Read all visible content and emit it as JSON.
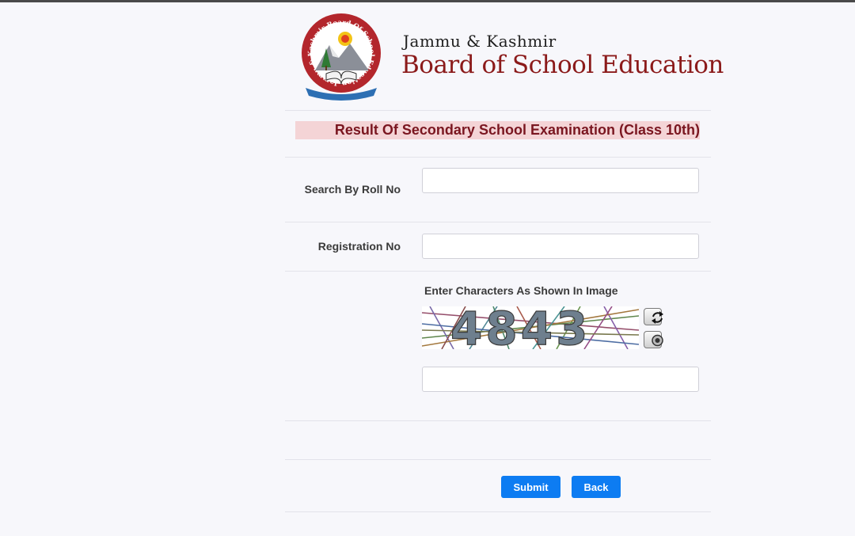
{
  "header": {
    "logo_name": "jkbose-emblem",
    "logo_ring_text": "Jammu & Kashmir Board Of School Education",
    "state_name": "Jammu & Kashmir",
    "board_name": "Board of School Education"
  },
  "page": {
    "heading": "Result Of Secondary School Examination (Class 10th)"
  },
  "form": {
    "roll_label": "Search By Roll No",
    "roll_value": "",
    "registration_label": "Registration No",
    "registration_value": "",
    "captcha_label": "Enter Characters As Shown In Image",
    "captcha_text": "4843",
    "captcha_value": "",
    "refresh_icon": "refresh-icon",
    "audio_icon": "audio-icon"
  },
  "actions": {
    "submit_label": "Submit",
    "back_label": "Back",
    "button_color": "#0d7cf2"
  },
  "colors": {
    "brand": "#8b1a1a",
    "heading_band": "#f4d4d6",
    "heading_text": "#7a1620"
  }
}
